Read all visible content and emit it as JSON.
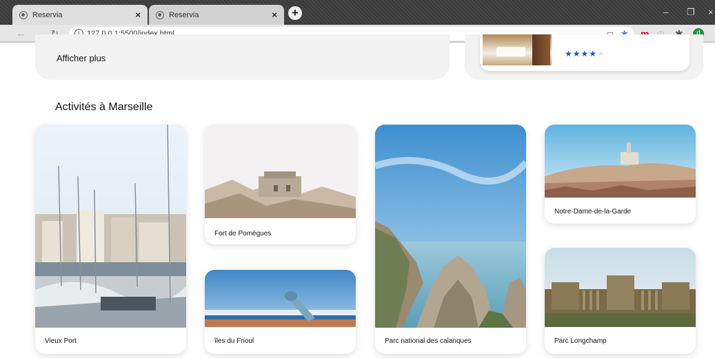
{
  "browser": {
    "tabs": [
      {
        "title": "Reservia",
        "close": "×"
      },
      {
        "title": "Reservia",
        "close": "×"
      }
    ],
    "new_tab": "+",
    "url": "127.0.0.1:5500/index.html",
    "window_controls": {
      "minimize": "–",
      "maximize": "❐",
      "close": "×"
    },
    "extensions": {
      "m": "m",
      "avatar": "d"
    }
  },
  "page": {
    "show_more": "Afficher plus",
    "hotel_rating": 4,
    "hotel_stars_max": 5,
    "section_title": "Activités à Marseille",
    "activities": [
      {
        "name": "Vieux Port"
      },
      {
        "name": "Fort de Pomègues"
      },
      {
        "name": "îles du Frioul"
      },
      {
        "name": "Parc national des calanques"
      },
      {
        "name": "Notre-Dame-de-la-Garde"
      },
      {
        "name": "Parc Longchamp"
      }
    ]
  },
  "colors": {
    "accent_star": "#1a56c8",
    "panel_bg": "#f2f2f2"
  }
}
